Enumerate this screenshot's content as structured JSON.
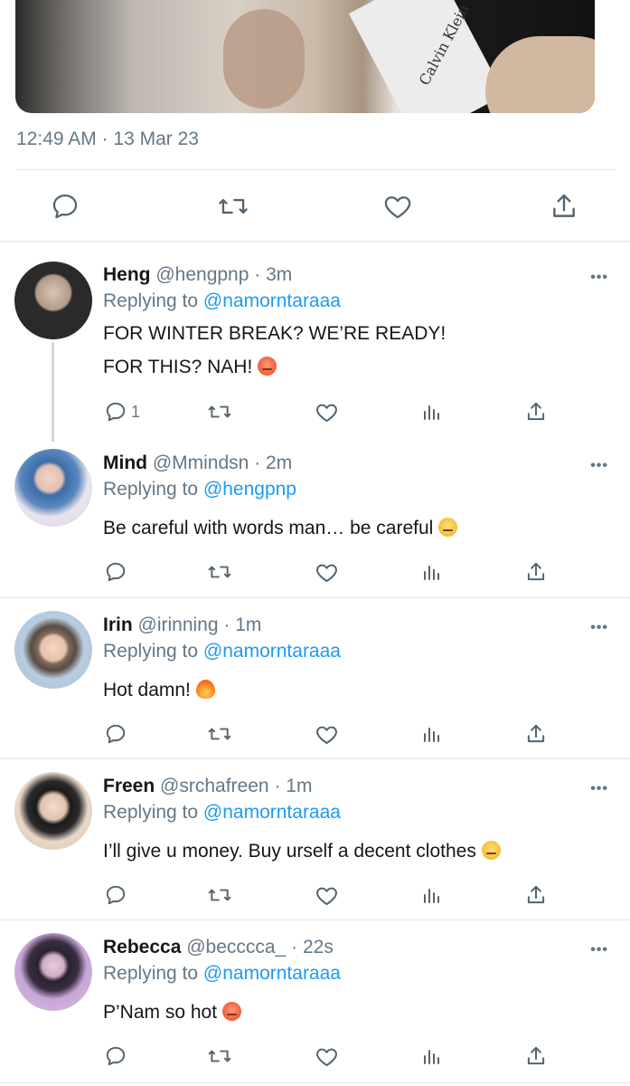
{
  "tweet": {
    "media_watermark": "Calvin Klein",
    "timestamp": "12:49 AM · 13 Mar 23"
  },
  "main_actions": [
    "reply",
    "retweet",
    "like",
    "share"
  ],
  "replies": [
    {
      "name": "Heng",
      "handle": "@hengpnp",
      "time": "3m",
      "replying_label": "Replying to",
      "mention": "@namorntaraaa",
      "lines": [
        "FOR WINTER BREAK? WE’RE READY!",
        "FOR THIS? NAH!"
      ],
      "emoji": "hot-face",
      "reply_count": "1",
      "avatar_colors": [
        "#2a2a2a",
        "#d9c4b4"
      ]
    },
    {
      "name": "Mind",
      "handle": "@Mmindsn",
      "time": "2m",
      "replying_label": "Replying to",
      "mention": "@hengpnp",
      "lines": [
        "Be careful with words man… be careful"
      ],
      "emoji": "smirk",
      "reply_count": "",
      "avatar_colors": [
        "#3d6ea8",
        "#e8e4ee"
      ]
    },
    {
      "name": "Irin",
      "handle": "@irinning",
      "time": "1m",
      "replying_label": "Replying to",
      "mention": "@namorntaraaa",
      "lines": [
        "Hot damn!"
      ],
      "emoji": "fire",
      "reply_count": "",
      "avatar_colors": [
        "#7a6a5c",
        "#b9cde0"
      ]
    },
    {
      "name": "Freen",
      "handle": "@srchafreen",
      "time": "1m",
      "replying_label": "Replying to",
      "mention": "@namorntaraaa",
      "lines": [
        "I’ll give u money. Buy urself a decent clothes"
      ],
      "emoji": "smirk",
      "reply_count": "",
      "avatar_colors": [
        "#1b1b1b",
        "#e9d8c8"
      ]
    },
    {
      "name": "Rebecca",
      "handle": "@becccca_",
      "time": "22s",
      "replying_label": "Replying to",
      "mention": "@namorntaraaa",
      "lines": [
        "P’Nam so hot"
      ],
      "emoji": "hot-face",
      "reply_count": "",
      "avatar_colors": [
        "#c7a6d6",
        "#2a2230"
      ]
    }
  ],
  "colors": {
    "accent": "#1d9bf0",
    "secondary_text": "#657786",
    "divider": "#dfe3e6"
  }
}
